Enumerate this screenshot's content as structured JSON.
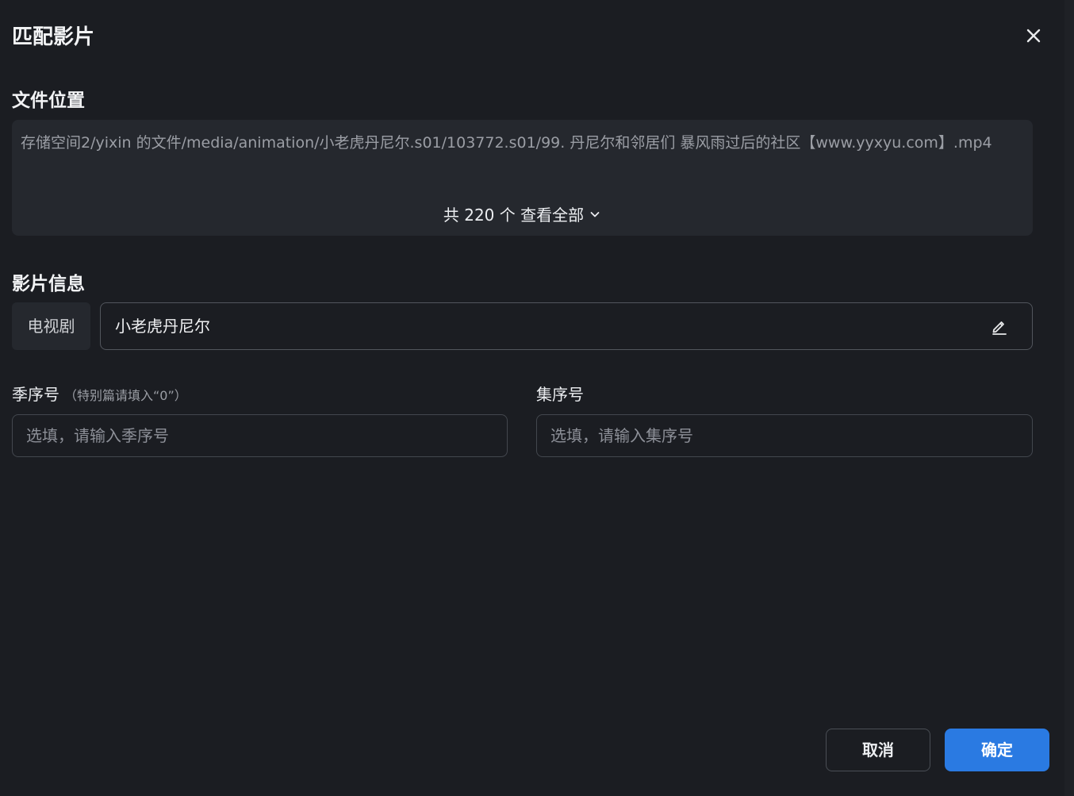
{
  "dialog": {
    "title": "匹配影片",
    "close_icon": "close-icon"
  },
  "file_location": {
    "section_title": "文件位置",
    "path": "存储空间2/yixin 的文件/media/animation/小老虎丹尼尔.s01/103772.s01/99. 丹尼尔和邻居们 暴风雨过后的社区【www.yyxyu.com】.mp4",
    "view_all_label": "共 220 个 查看全部",
    "view_all_icon": "chevron-down-icon"
  },
  "movie_info": {
    "section_title": "影片信息",
    "type_label": "电视剧",
    "title_value": "小老虎丹尼尔",
    "edit_icon": "pencil-icon"
  },
  "season": {
    "label": "季序号",
    "hint": "（特别篇请填入“0”）",
    "placeholder": "选填，请输入季序号",
    "value": ""
  },
  "episode": {
    "label": "集序号",
    "placeholder": "选填，请输入集序号",
    "value": ""
  },
  "actions": {
    "cancel_label": "取消",
    "confirm_label": "确定"
  },
  "colors": {
    "background": "#1b1d22",
    "panel": "#25282e",
    "accent": "#2a7ae2"
  }
}
